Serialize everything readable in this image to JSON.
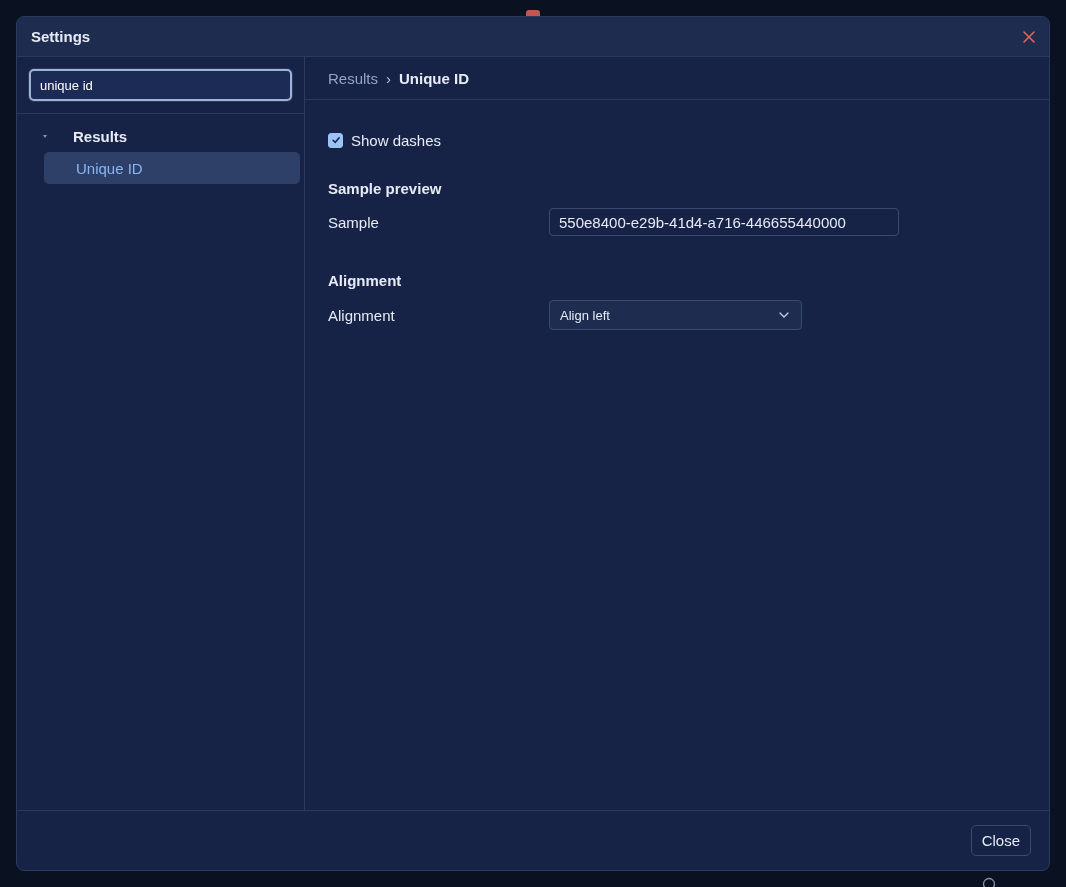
{
  "dialog": {
    "title": "Settings",
    "search": {
      "value": "unique id"
    },
    "tree": [
      {
        "label": "Results",
        "expanded": true,
        "selected": false,
        "children": [
          {
            "label": "Unique ID",
            "selected": true
          }
        ]
      }
    ],
    "breadcrumb": [
      "Results",
      "Unique ID"
    ],
    "breadcrumb_separator": "›",
    "settings": [
      {
        "kind": "checkbox",
        "label": "Show dashes",
        "checked": true
      },
      {
        "kind": "heading",
        "label": "Sample preview"
      },
      {
        "kind": "text",
        "label": "Sample",
        "value": "550e8400-e29b-41d4-a716-446655440000"
      },
      {
        "kind": "heading",
        "label": "Alignment"
      },
      {
        "kind": "select",
        "label": "Alignment",
        "value": "Align left"
      }
    ],
    "buttons": [
      "Close"
    ]
  }
}
